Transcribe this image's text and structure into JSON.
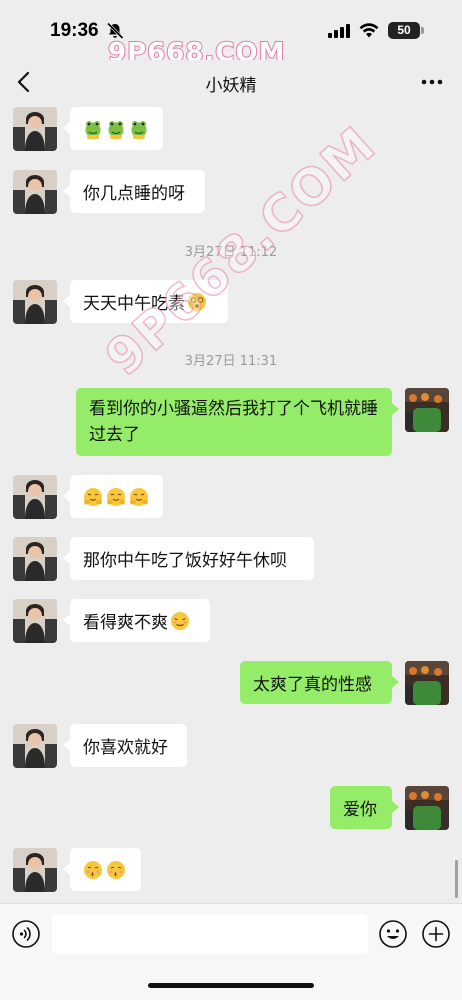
{
  "status_bar": {
    "time": "19:36",
    "battery": "50",
    "icons": [
      "bell-slash-icon",
      "signal-icon",
      "wifi-icon",
      "battery-icon"
    ]
  },
  "watermarks": {
    "top": "9P668.COM",
    "diagonal": "9P668.COM"
  },
  "nav": {
    "title": "小妖精",
    "back_icon": "chevron-left-icon",
    "more_icon": "more-dots-icon"
  },
  "messages": [
    {
      "side": "left",
      "type": "emoji",
      "emojis": [
        "frog-emoji",
        "frog-emoji",
        "frog-emoji"
      ]
    },
    {
      "side": "left",
      "type": "text",
      "text": "你几点睡的呀"
    },
    {
      "type": "timestamp",
      "text": "3月27日 11:12"
    },
    {
      "side": "left",
      "type": "text",
      "text": "天天中午吃素",
      "emojis": [
        "dizzy-face-emoji"
      ]
    },
    {
      "type": "timestamp",
      "text": "3月27日 11:31"
    },
    {
      "side": "right",
      "type": "text",
      "text": "看到你的小骚逼然后我打了个飞机就睡过去了"
    },
    {
      "side": "left",
      "type": "emoji",
      "emojis": [
        "hug-face-emoji",
        "hug-face-emoji",
        "hug-face-emoji"
      ]
    },
    {
      "side": "left",
      "type": "text",
      "text": "那你中午吃了饭好好午休呗"
    },
    {
      "side": "left",
      "type": "text",
      "text": "看得爽不爽",
      "emojis": [
        "smirk-face-emoji"
      ]
    },
    {
      "side": "right",
      "type": "text",
      "text": "太爽了真的性感"
    },
    {
      "side": "left",
      "type": "text",
      "text": "你喜欢就好"
    },
    {
      "side": "right",
      "type": "text",
      "text": "爱你"
    },
    {
      "side": "left",
      "type": "emoji",
      "emojis": [
        "kiss-face-emoji",
        "kiss-face-emoji"
      ]
    }
  ],
  "input_bar": {
    "voice_icon": "voice-icon",
    "emoji_icon": "smile-icon",
    "plus_icon": "plus-icon",
    "text_value": ""
  },
  "colors": {
    "background": "#ededed",
    "bubble_right": "#95ec69",
    "bubble_left": "#ffffff",
    "timestamp": "#9b9b9b",
    "watermark": "#e37ea6"
  }
}
